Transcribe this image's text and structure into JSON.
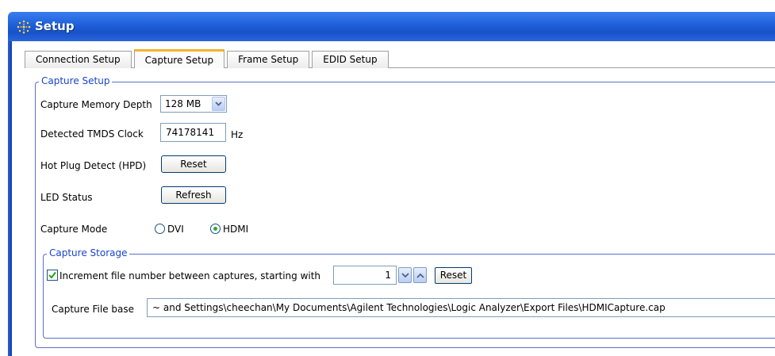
{
  "window": {
    "title": "Setup"
  },
  "tabs": [
    {
      "label": "Connection Setup"
    },
    {
      "label": "Capture Setup",
      "active": true
    },
    {
      "label": "Frame Setup"
    },
    {
      "label": "EDID Setup"
    }
  ],
  "capture_setup": {
    "legend": "Capture Setup",
    "memory_depth": {
      "label": "Capture Memory Depth",
      "value": "128 MB"
    },
    "tmds_clock": {
      "label": "Detected TMDS Clock",
      "value": "74178141",
      "unit": "Hz"
    },
    "hpd": {
      "label": "Hot Plug Detect (HPD)",
      "button": "Reset"
    },
    "led_status": {
      "label": "LED Status",
      "button": "Refresh"
    },
    "capture_mode": {
      "label": "Capture Mode",
      "options": [
        {
          "label": "DVI",
          "selected": false
        },
        {
          "label": "HDMI",
          "selected": true
        }
      ]
    }
  },
  "capture_storage": {
    "legend": "Capture Storage",
    "increment": {
      "checked": true,
      "label": "Increment file number between captures, starting with",
      "value": "1",
      "reset_button": "Reset"
    },
    "file_base": {
      "label": "Capture File base",
      "value": "~ and Settings\\cheechan\\My Documents\\Agilent Technologies\\Logic Analyzer\\Export Files\\HDMICapture.cap"
    }
  },
  "colors": {
    "title_bar": "#1e5fd8",
    "active_tab_accent": "#f4b332",
    "group_border": "#5c6fc9",
    "legend_text": "#1a45c8",
    "radio_selected": "#35a72e"
  }
}
